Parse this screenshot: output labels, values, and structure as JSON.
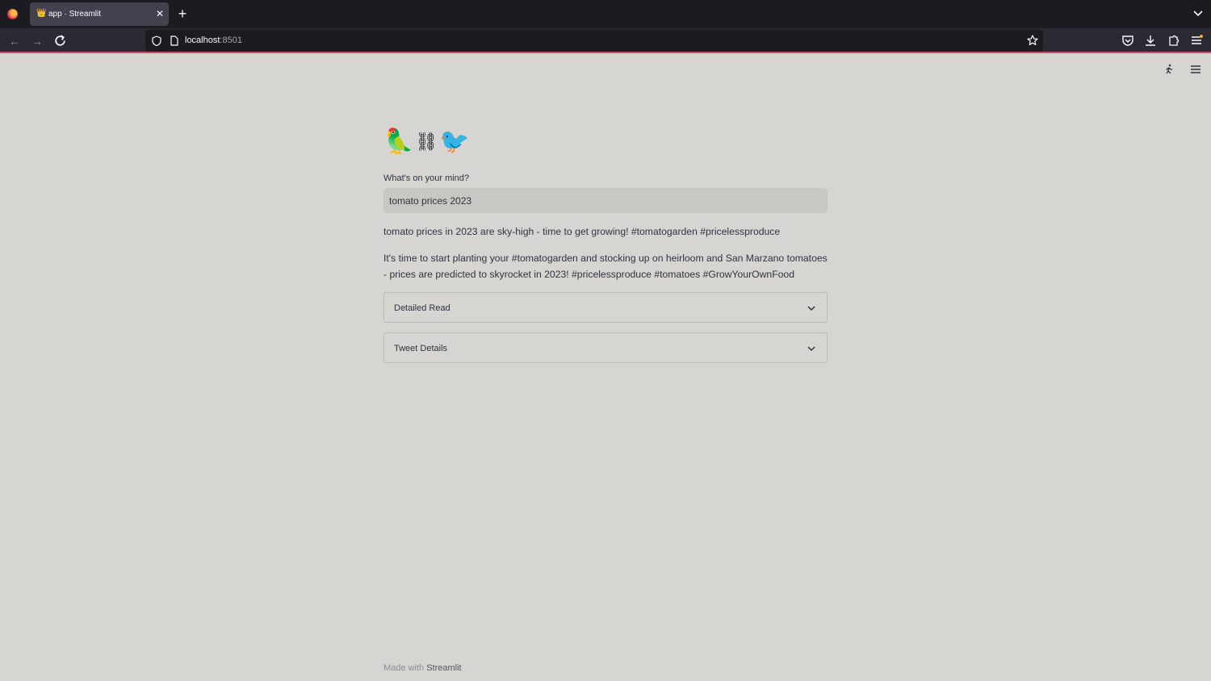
{
  "browser": {
    "tab": {
      "title": "app · Streamlit",
      "favicon": "👑"
    },
    "url": {
      "host": "localhost",
      "port": ":8501"
    }
  },
  "app": {
    "title_emojis": [
      "🦜",
      "⛓",
      "🐦"
    ],
    "input": {
      "label": "What's on your mind?",
      "value": "tomato prices 2023"
    },
    "output": {
      "paragraph1": "tomato prices in 2023 are sky-high - time to get growing! #tomatogarden #pricelessproduce",
      "paragraph2": "It's time to start planting your #tomatogarden and stocking up on heirloom and San Marzano tomatoes - prices are predicted to skyrocket in 2023! #pricelessproduce #tomatoes #GrowYourOwnFood"
    },
    "expanders": [
      {
        "label": "Detailed Read"
      },
      {
        "label": "Tweet Details"
      }
    ],
    "footer": {
      "prefix": "Made with ",
      "brand": "Streamlit"
    }
  }
}
